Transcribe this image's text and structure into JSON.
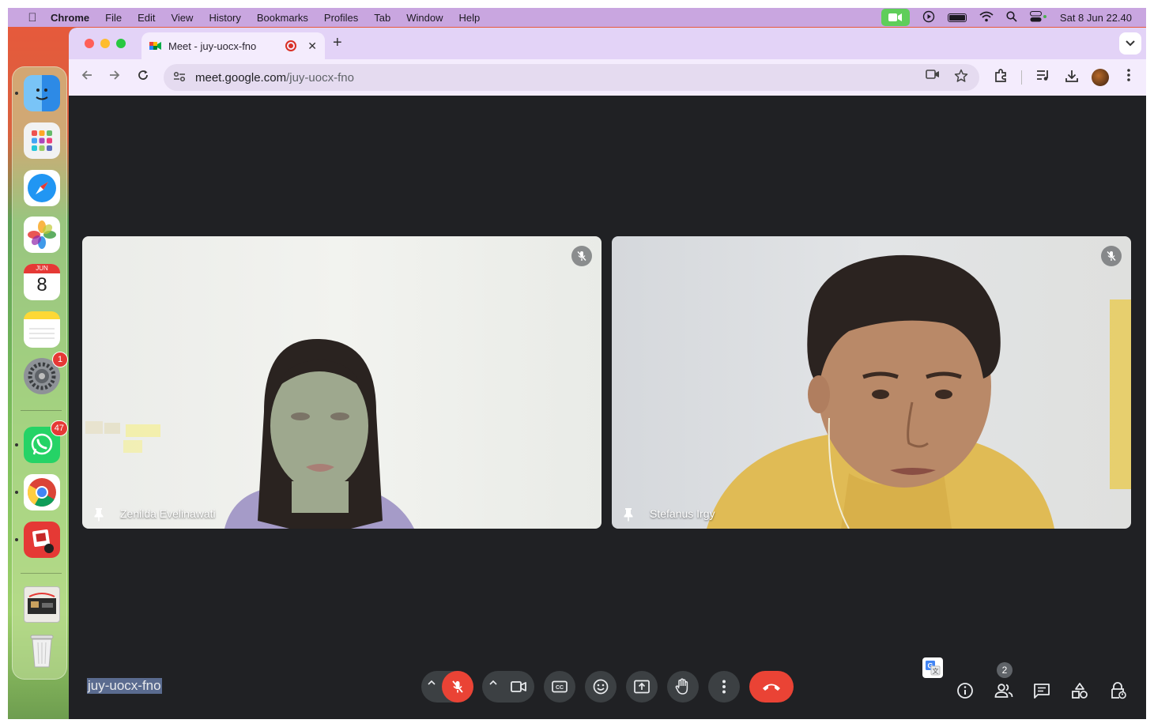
{
  "menubar": {
    "app_name": "Chrome",
    "items": [
      "File",
      "Edit",
      "View",
      "History",
      "Bookmarks",
      "Profiles",
      "Tab",
      "Window",
      "Help"
    ],
    "clock": "Sat 8 Jun  22.40"
  },
  "dock": {
    "calendar_month": "JUN",
    "calendar_day": "8",
    "settings_badge": "1",
    "whatsapp_badge": "47"
  },
  "browser": {
    "tab_title": "Meet - juy-uocx-fno",
    "url_host": "meet.google.com",
    "url_path": "/juy-uocx-fno"
  },
  "meet": {
    "participants": [
      {
        "name": "Zenilda Evelinawati",
        "muted": true
      },
      {
        "name": "Stefanus Irgy",
        "muted": true
      }
    ],
    "meeting_code": "juy-uocx-fno",
    "people_count": "2"
  },
  "colors": {
    "meet_bg": "#202124",
    "control_bg": "#3c4043",
    "end_call": "#ea4335",
    "tab_strip": "#e3d3f7",
    "menubar": "#c9a6e0"
  }
}
